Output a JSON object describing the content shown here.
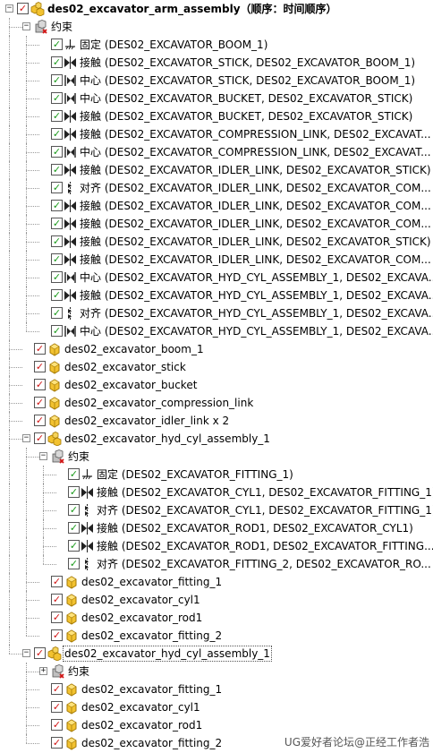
{
  "tree": [
    {
      "level": 0,
      "kind": "assembly",
      "exp": "minus",
      "cb": "red",
      "text": "des02_excavator_arm_assembly（顺序：时间顺序）",
      "bold": true
    },
    {
      "level": 1,
      "kind": "constraints",
      "exp": "minus",
      "text": "约束"
    },
    {
      "level": 2,
      "kind": "constraint",
      "ctype": "fix",
      "cb": "green",
      "text": "固定 (DES02_EXCAVATOR_BOOM_1)"
    },
    {
      "level": 2,
      "kind": "constraint",
      "ctype": "touch",
      "cb": "green",
      "text": "接触 (DES02_EXCAVATOR_STICK, DES02_EXCAVATOR_BOOM_1)"
    },
    {
      "level": 2,
      "kind": "constraint",
      "ctype": "center",
      "cb": "green",
      "text": "中心 (DES02_EXCAVATOR_STICK, DES02_EXCAVATOR_BOOM_1)"
    },
    {
      "level": 2,
      "kind": "constraint",
      "ctype": "center",
      "cb": "green",
      "text": "中心 (DES02_EXCAVATOR_BUCKET, DES02_EXCAVATOR_STICK)"
    },
    {
      "level": 2,
      "kind": "constraint",
      "ctype": "touch",
      "cb": "green",
      "text": "接触 (DES02_EXCAVATOR_BUCKET, DES02_EXCAVATOR_STICK)"
    },
    {
      "level": 2,
      "kind": "constraint",
      "ctype": "touch",
      "cb": "green",
      "text": "接触 (DES02_EXCAVATOR_COMPRESSION_LINK, DES02_EXCAVAT..."
    },
    {
      "level": 2,
      "kind": "constraint",
      "ctype": "center",
      "cb": "green",
      "text": "中心 (DES02_EXCAVATOR_COMPRESSION_LINK, DES02_EXCAVAT..."
    },
    {
      "level": 2,
      "kind": "constraint",
      "ctype": "touch",
      "cb": "green",
      "text": "接触 (DES02_EXCAVATOR_IDLER_LINK, DES02_EXCAVATOR_STICK)"
    },
    {
      "level": 2,
      "kind": "constraint",
      "ctype": "align",
      "cb": "green",
      "text": "对齐 (DES02_EXCAVATOR_IDLER_LINK, DES02_EXCAVATOR_COM..."
    },
    {
      "level": 2,
      "kind": "constraint",
      "ctype": "touch",
      "cb": "green",
      "text": "接触 (DES02_EXCAVATOR_IDLER_LINK, DES02_EXCAVATOR_COM..."
    },
    {
      "level": 2,
      "kind": "constraint",
      "ctype": "touch",
      "cb": "green",
      "text": "接触 (DES02_EXCAVATOR_IDLER_LINK, DES02_EXCAVATOR_COM..."
    },
    {
      "level": 2,
      "kind": "constraint",
      "ctype": "touch",
      "cb": "green",
      "text": "接触 (DES02_EXCAVATOR_IDLER_LINK, DES02_EXCAVATOR_STICK)"
    },
    {
      "level": 2,
      "kind": "constraint",
      "ctype": "touch",
      "cb": "green",
      "text": "接触 (DES02_EXCAVATOR_IDLER_LINK, DES02_EXCAVATOR_COM..."
    },
    {
      "level": 2,
      "kind": "constraint",
      "ctype": "center",
      "cb": "green",
      "text": "中心 (DES02_EXCAVATOR_HYD_CYL_ASSEMBLY_1, DES02_EXCAVA..."
    },
    {
      "level": 2,
      "kind": "constraint",
      "ctype": "touch",
      "cb": "green",
      "text": "接触 (DES02_EXCAVATOR_HYD_CYL_ASSEMBLY_1, DES02_EXCAVA..."
    },
    {
      "level": 2,
      "kind": "constraint",
      "ctype": "align",
      "cb": "green",
      "text": "对齐 (DES02_EXCAVATOR_HYD_CYL_ASSEMBLY_1, DES02_EXCAVA..."
    },
    {
      "level": 2,
      "kind": "constraint",
      "ctype": "center",
      "cb": "green",
      "text": "中心 (DES02_EXCAVATOR_HYD_CYL_ASSEMBLY_1, DES02_EXCAVA..."
    },
    {
      "level": 1,
      "kind": "part",
      "cb": "red",
      "text": "des02_excavator_boom_1"
    },
    {
      "level": 1,
      "kind": "part",
      "cb": "red",
      "text": "des02_excavator_stick"
    },
    {
      "level": 1,
      "kind": "part",
      "cb": "red",
      "text": "des02_excavator_bucket"
    },
    {
      "level": 1,
      "kind": "part",
      "cb": "red",
      "text": "des02_excavator_compression_link"
    },
    {
      "level": 1,
      "kind": "part",
      "cb": "red",
      "text": "des02_excavator_idler_link x 2"
    },
    {
      "level": 1,
      "kind": "assembly",
      "exp": "minus",
      "cb": "red",
      "text": "des02_excavator_hyd_cyl_assembly_1"
    },
    {
      "level": 2,
      "kind": "constraints",
      "exp": "minus",
      "text": "约束"
    },
    {
      "level": 3,
      "kind": "constraint",
      "ctype": "fix",
      "cb": "green",
      "text": "固定 (DES02_EXCAVATOR_FITTING_1)"
    },
    {
      "level": 3,
      "kind": "constraint",
      "ctype": "touch",
      "cb": "green",
      "text": "接触 (DES02_EXCAVATOR_CYL1, DES02_EXCAVATOR_FITTING_1)"
    },
    {
      "level": 3,
      "kind": "constraint",
      "ctype": "align",
      "cb": "green",
      "text": "对齐 (DES02_EXCAVATOR_CYL1, DES02_EXCAVATOR_FITTING_1)"
    },
    {
      "level": 3,
      "kind": "constraint",
      "ctype": "touch",
      "cb": "green",
      "text": "接触 (DES02_EXCAVATOR_ROD1, DES02_EXCAVATOR_CYL1)"
    },
    {
      "level": 3,
      "kind": "constraint",
      "ctype": "touch",
      "cb": "green",
      "text": "接触 (DES02_EXCAVATOR_ROD1, DES02_EXCAVATOR_FITTING..."
    },
    {
      "level": 3,
      "kind": "constraint",
      "ctype": "align",
      "cb": "green",
      "text": "对齐 (DES02_EXCAVATOR_FITTING_2, DES02_EXCAVATOR_RO..."
    },
    {
      "level": 2,
      "kind": "part",
      "cb": "red",
      "text": "des02_excavator_fitting_1"
    },
    {
      "level": 2,
      "kind": "part",
      "cb": "red",
      "text": "des02_excavator_cyl1"
    },
    {
      "level": 2,
      "kind": "part",
      "cb": "red",
      "text": "des02_excavator_rod1"
    },
    {
      "level": 2,
      "kind": "part",
      "cb": "red",
      "text": "des02_excavator_fitting_2"
    },
    {
      "level": 1,
      "kind": "assembly",
      "exp": "minus",
      "cb": "red",
      "text": "des02_excavator_hyd_cyl_assembly_1",
      "selected": true
    },
    {
      "level": 2,
      "kind": "constraints",
      "exp": "plus",
      "text": "约束"
    },
    {
      "level": 2,
      "kind": "part",
      "cb": "red",
      "text": "des02_excavator_fitting_1"
    },
    {
      "level": 2,
      "kind": "part",
      "cb": "red",
      "text": "des02_excavator_cyl1"
    },
    {
      "level": 2,
      "kind": "part",
      "cb": "red",
      "text": "des02_excavator_rod1"
    },
    {
      "level": 2,
      "kind": "part",
      "cb": "red",
      "text": "des02_excavator_fitting_2"
    }
  ],
  "watermark": "UG爱好者论坛@正经工作者浩",
  "colors": {
    "check_red": "#d11313",
    "check_green": "#1a9a1a",
    "part_yellow": "#f2c230"
  }
}
